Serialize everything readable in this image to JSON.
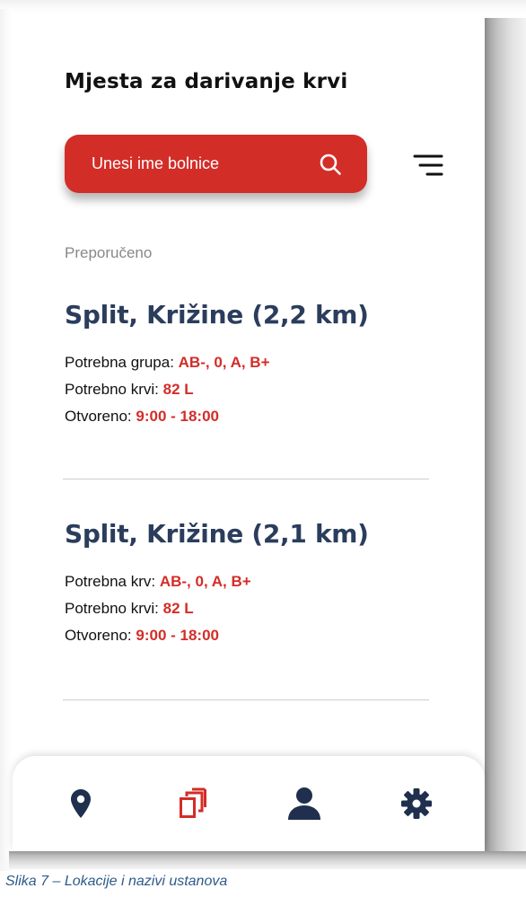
{
  "header": {
    "title": "Mjesta za darivanje krvi"
  },
  "search": {
    "placeholder": "Unesi ime bolnice",
    "icon": "search-icon"
  },
  "filter": {
    "icon": "filter-icon"
  },
  "section": {
    "label": "Preporučeno"
  },
  "locations": [
    {
      "name": "Split, Križine (2,2 km)",
      "group_label": "Potrebna grupa:",
      "group_value": "AB-, 0, A, B+",
      "blood_label": "Potrebno krvi:",
      "blood_value": "82 L",
      "open_label": "Otvoreno:",
      "open_value": "9:00 - 18:00"
    },
    {
      "name": "Split, Križine (2,1 km)",
      "group_label": "Potrebna krv:",
      "group_value": "AB-, 0, A, B+",
      "blood_label": "Potrebno krvi:",
      "blood_value": "82 L",
      "open_label": "Otvoreno:",
      "open_value": "9:00 - 18:00"
    }
  ],
  "nav": {
    "items": [
      {
        "icon": "map-pin-icon",
        "active": false
      },
      {
        "icon": "copy-icon",
        "active": true
      },
      {
        "icon": "user-icon",
        "active": false
      },
      {
        "icon": "gear-icon",
        "active": false
      }
    ]
  },
  "colors": {
    "accent": "#d32d28",
    "heading": "#2b3d5c",
    "nav_icon": "#1f2f4d"
  },
  "caption": "Slika 7 – Lokacije i nazivi ustanova"
}
